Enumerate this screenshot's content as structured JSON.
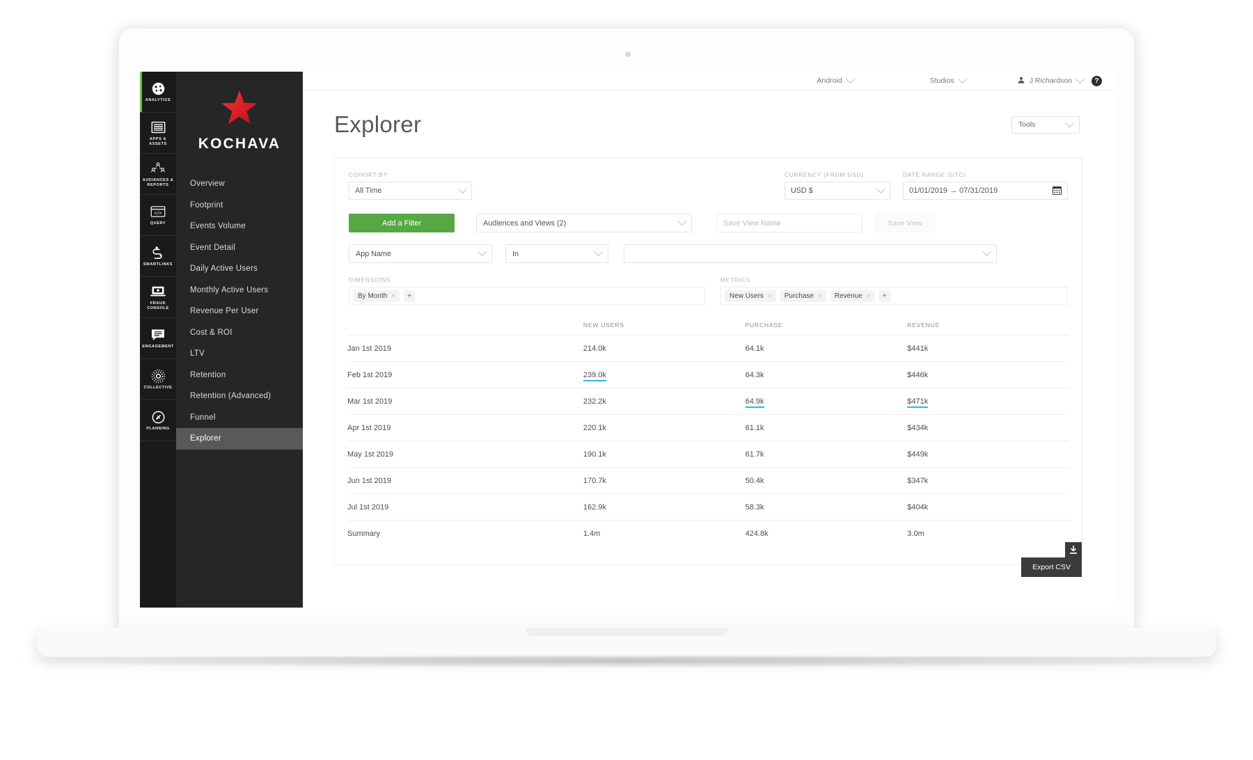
{
  "topbar": {
    "platform": "Android",
    "account": "Studios",
    "user": "J Richardson",
    "help": "?"
  },
  "page": {
    "title": "Explorer",
    "tools_label": "Tools"
  },
  "brand": {
    "name": "KOCHAVA"
  },
  "rail": [
    {
      "label": "ANALYTICS",
      "icon": "analytics-icon",
      "active": true
    },
    {
      "label": "APPS &\nASSETS",
      "icon": "apps-assets-icon",
      "active": false
    },
    {
      "label": "AUDIENCES &\nREPORTS",
      "icon": "audiences-reports-icon",
      "active": false
    },
    {
      "label": "QUERY",
      "icon": "query-icon",
      "active": false
    },
    {
      "label": "SMARTLINKS",
      "icon": "smartlinks-icon",
      "active": false
    },
    {
      "label": "FRAUD\nCONSOLE",
      "icon": "fraud-console-icon",
      "active": false
    },
    {
      "label": "ENGAGEMENT",
      "icon": "engagement-icon",
      "active": false
    },
    {
      "label": "COLLECTIVE",
      "icon": "collective-icon",
      "active": false
    },
    {
      "label": "PLANNING",
      "icon": "planning-icon",
      "active": false
    }
  ],
  "nav": [
    {
      "label": "Overview"
    },
    {
      "label": "Footprint"
    },
    {
      "label": "Events Volume"
    },
    {
      "label": "Event Detail"
    },
    {
      "label": "Daily Active Users"
    },
    {
      "label": "Monthly Active Users"
    },
    {
      "label": "Revenue Per User"
    },
    {
      "label": "Cost & ROI"
    },
    {
      "label": "LTV"
    },
    {
      "label": "Retention"
    },
    {
      "label": "Retention (Advanced)"
    },
    {
      "label": "Funnel"
    },
    {
      "label": "Explorer",
      "active": true
    }
  ],
  "controls": {
    "cohort_label": "COHORT BY",
    "cohort_value": "All Time",
    "currency_label": "CURRENCY (FROM USD)",
    "currency_value": "USD $",
    "daterange_label": "DATE RANGE (UTC)",
    "daterange_value": "01/01/2019 → 07/31/2019",
    "add_filter": "Add a Filter",
    "audiences_value": "Audiences and Views (2)",
    "save_view_placeholder": "Save View Name",
    "save_view_button": "Save View",
    "filter_field": "App Name",
    "filter_operator": "In",
    "filter_value": ""
  },
  "dimensions": {
    "label": "DIMENSIONS",
    "tags": [
      "By Month"
    ],
    "add": "+"
  },
  "metrics": {
    "label": "METRICS",
    "tags": [
      "New Users",
      "Purchase",
      "Revenue"
    ],
    "add": "+"
  },
  "table": {
    "headers": [
      "",
      "NEW USERS",
      "PURCHASE",
      "REVENUE"
    ],
    "rows": [
      {
        "dim": "Jan 1st 2019",
        "new_users": "214.0k",
        "purchase": "64.1k",
        "revenue": "$441k",
        "faded": [
          false,
          false,
          false
        ],
        "highlight": [
          false,
          false,
          false
        ]
      },
      {
        "dim": "Feb 1st 2019",
        "new_users": "239.0k",
        "purchase": "64.3k",
        "revenue": "$446k",
        "faded": [
          false,
          false,
          false
        ],
        "highlight": [
          true,
          false,
          false
        ]
      },
      {
        "dim": "Mar 1st 2019",
        "new_users": "232.2k",
        "purchase": "64.9k",
        "revenue": "$471k",
        "faded": [
          false,
          false,
          false
        ],
        "highlight": [
          false,
          true,
          true
        ]
      },
      {
        "dim": "Apr 1st 2019",
        "new_users": "220.1k",
        "purchase": "61.1k",
        "revenue": "$434k",
        "faded": [
          false,
          false,
          false
        ],
        "highlight": [
          false,
          false,
          false
        ]
      },
      {
        "dim": "May 1st 2019",
        "new_users": "190.1k",
        "purchase": "61.7k",
        "revenue": "$449k",
        "faded": [
          true,
          false,
          false
        ],
        "highlight": [
          false,
          false,
          false
        ]
      },
      {
        "dim": "Jun 1st 2019",
        "new_users": "170.7k",
        "purchase": "50.4k",
        "revenue": "$347k",
        "faded": [
          true,
          true,
          true
        ],
        "highlight": [
          false,
          false,
          false
        ]
      },
      {
        "dim": "Jul 1st 2019",
        "new_users": "162.9k",
        "purchase": "58.3k",
        "revenue": "$404k",
        "faded": [
          true,
          false,
          false
        ],
        "highlight": [
          false,
          false,
          false
        ]
      }
    ],
    "summary": {
      "dim": "Summary",
      "new_users": "1.4m",
      "purchase": "424.8k",
      "revenue": "3.0m"
    }
  },
  "export": {
    "tooltip": "Export CSV"
  },
  "colors": {
    "accent_green": "#56a845",
    "highlight_blue": "#29b6e8",
    "rail_bg": "#1a1a1a",
    "nav_bg": "#262626",
    "nav_active": "#595959",
    "brand_red": "#d81f26"
  }
}
